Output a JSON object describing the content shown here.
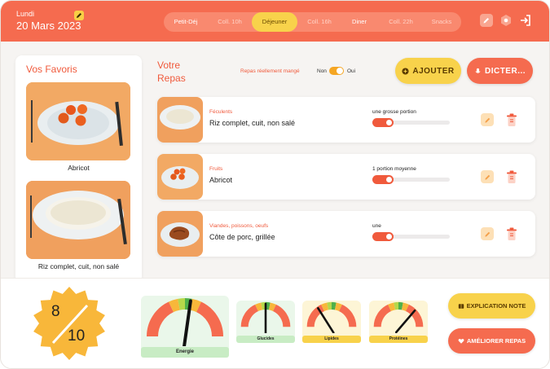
{
  "header": {
    "day_label": "Lundi",
    "date": "20 Mars 2023",
    "meals": [
      {
        "label": "Petit-Déj",
        "state": "bright"
      },
      {
        "label": "Coll. 10h",
        "state": "dim"
      },
      {
        "label": "Déjeuner",
        "state": "active"
      },
      {
        "label": "Coll. 16h",
        "state": "dim"
      },
      {
        "label": "Diner",
        "state": "bright"
      },
      {
        "label": "Coll. 22h",
        "state": "dim"
      },
      {
        "label": "Snacks",
        "state": "dim"
      }
    ],
    "icons": [
      "pencil-icon",
      "hexagon-settings-icon",
      "logout-icon"
    ]
  },
  "favorites": {
    "title": "Vos Favoris",
    "items": [
      {
        "label": "Abricot"
      },
      {
        "label": "Riz complet, cuit, non salé"
      }
    ]
  },
  "meal": {
    "title_line1": "Votre",
    "title_line2": "Repas",
    "eaten_label": "Repas réellement mangé",
    "toggle_no": "Non",
    "toggle_yes": "Oui",
    "toggle_on": true,
    "add_label": "AJOUTER",
    "dictate_label": "DICTER...",
    "items": [
      {
        "category": "Féculents",
        "name": "Riz complet, cuit, non salé",
        "portion": "une grosse portion",
        "level": 0.2
      },
      {
        "category": "Fruits",
        "name": "Abricot",
        "portion": "1 portion moyenne",
        "level": 0.2
      },
      {
        "category": "Viandes, poissons, oeufs",
        "name": "Côte de porc, grillée",
        "portion": "une",
        "level": 0.2
      }
    ]
  },
  "score": {
    "numerator": "8",
    "denominator": "10"
  },
  "gauges": [
    {
      "label": "Energie",
      "value": 0.55,
      "label_bg": "#c8ecc4"
    },
    {
      "label": "Glucides",
      "value": 0.5,
      "label_bg": "#c8ecc4"
    },
    {
      "label": "Lipides",
      "value": 0.3,
      "label_bg": "#f8d24b"
    },
    {
      "label": "Protéines",
      "value": 0.75,
      "label_bg": "#f8d24b"
    }
  ],
  "actions": {
    "explain_label": "EXPLICATION NOTE",
    "improve_label": "AMÉLIORER REPAS"
  },
  "colors": {
    "primary": "#f56b4f",
    "accent": "#f8d24b"
  }
}
